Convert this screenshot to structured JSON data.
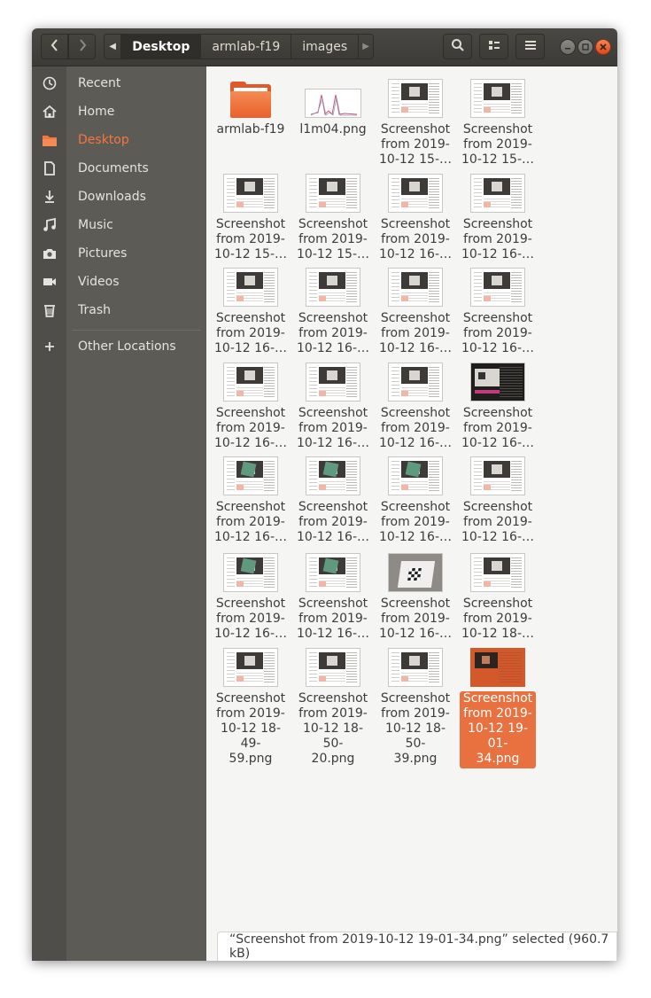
{
  "header": {
    "path": [
      "Desktop",
      "armlab-f19",
      "images"
    ],
    "active_index": 0
  },
  "sidebar": {
    "items": [
      {
        "label": "Recent",
        "icon": "clock-icon"
      },
      {
        "label": "Home",
        "icon": "home-icon"
      },
      {
        "label": "Desktop",
        "icon": "folder-icon",
        "active": true
      },
      {
        "label": "Documents",
        "icon": "document-icon"
      },
      {
        "label": "Downloads",
        "icon": "download-icon"
      },
      {
        "label": "Music",
        "icon": "music-icon"
      },
      {
        "label": "Pictures",
        "icon": "camera-icon"
      },
      {
        "label": "Videos",
        "icon": "video-icon"
      },
      {
        "label": "Trash",
        "icon": "trash-icon"
      }
    ],
    "other_locations": "Other Locations"
  },
  "files": [
    {
      "name": "armlab-f19",
      "kind": "folder"
    },
    {
      "name": "l1m04.png",
      "kind": "plot"
    },
    {
      "name": "Screenshot\nfrom 2019-\n10-12 15-…",
      "kind": "shot"
    },
    {
      "name": "Screenshot\nfrom 2019-\n10-12 15-…",
      "kind": "shot"
    },
    {
      "name": "Screenshot\nfrom 2019-\n10-12 15-…",
      "kind": "shot"
    },
    {
      "name": "Screenshot\nfrom 2019-\n10-12 15-…",
      "kind": "shot"
    },
    {
      "name": "Screenshot\nfrom 2019-\n10-12 16-…",
      "kind": "shot"
    },
    {
      "name": "Screenshot\nfrom 2019-\n10-12 16-…",
      "kind": "shot"
    },
    {
      "name": "Screenshot\nfrom 2019-\n10-12 16-…",
      "kind": "shot"
    },
    {
      "name": "Screenshot\nfrom 2019-\n10-12 16-…",
      "kind": "shot"
    },
    {
      "name": "Screenshot\nfrom 2019-\n10-12 16-…",
      "kind": "shot"
    },
    {
      "name": "Screenshot\nfrom 2019-\n10-12 16-…",
      "kind": "shot"
    },
    {
      "name": "Screenshot\nfrom 2019-\n10-12 16-…",
      "kind": "shot"
    },
    {
      "name": "Screenshot\nfrom 2019-\n10-12 16-…",
      "kind": "shot"
    },
    {
      "name": "Screenshot\nfrom 2019-\n10-12 16-…",
      "kind": "shot"
    },
    {
      "name": "Screenshot\nfrom 2019-\n10-12 16-…",
      "kind": "dark"
    },
    {
      "name": "Screenshot\nfrom 2019-\n10-12 16-…",
      "kind": "green"
    },
    {
      "name": "Screenshot\nfrom 2019-\n10-12 16-…",
      "kind": "green"
    },
    {
      "name": "Screenshot\nfrom 2019-\n10-12 16-…",
      "kind": "green"
    },
    {
      "name": "Screenshot\nfrom 2019-\n10-12 16-…",
      "kind": "shot"
    },
    {
      "name": "Screenshot\nfrom 2019-\n10-12 16-…",
      "kind": "green"
    },
    {
      "name": "Screenshot\nfrom 2019-\n10-12 16-…",
      "kind": "green"
    },
    {
      "name": "Screenshot\nfrom 2019-\n10-12 16-…",
      "kind": "photo"
    },
    {
      "name": "Screenshot\nfrom 2019-\n10-12 18-…",
      "kind": "shot"
    },
    {
      "name": "Screenshot\nfrom 2019-\n10-12 18-49-\n59.png",
      "kind": "shot"
    },
    {
      "name": "Screenshot\nfrom 2019-\n10-12 18-50-\n20.png",
      "kind": "shot"
    },
    {
      "name": "Screenshot\nfrom 2019-\n10-12 18-50-\n39.png",
      "kind": "shot"
    },
    {
      "name": "Screenshot\nfrom 2019-\n10-12 19-01-\n34.png",
      "kind": "orange",
      "selected": true
    }
  ],
  "status": {
    "text": "“Screenshot from 2019-10-12 19-01-34.png” selected  (960.7 kB)"
  },
  "colors": {
    "accent": "#e9713f",
    "sidebar_bg": "#5c5b56",
    "header_bg": "#3c3b37"
  }
}
